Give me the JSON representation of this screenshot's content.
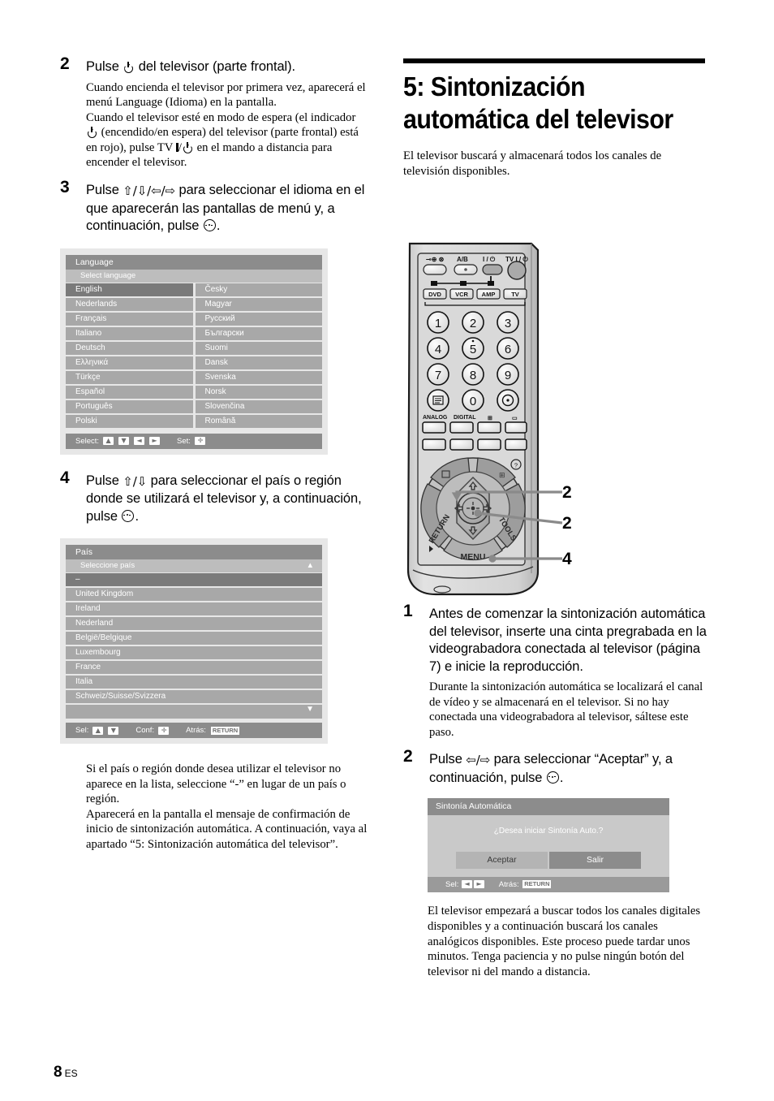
{
  "left_column": {
    "step2": {
      "num": "2",
      "head_pre": "Pulse ",
      "head_post": " del televisor (parte frontal).",
      "body_p1": "Cuando encienda el televisor por primera vez, aparecerá el menú Language (Idioma) en la pantalla.",
      "body_p2_a": "Cuando el televisor esté en modo de espera (el indicador ",
      "body_p2_b": " (encendido/en espera) del televisor (parte frontal) está en rojo), pulse TV ",
      "body_p2_c": " en el mando a distancia para encender el televisor."
    },
    "step3": {
      "num": "3",
      "head_a": "Pulse ",
      "head_arrows": "⇧/⇩/⇦/⇨",
      "head_b": " para seleccionar el idioma en el que aparecerán las pantallas de menú y, a continuación, pulse ",
      "head_c": "."
    },
    "language_menu": {
      "title": "Language",
      "subtitle": "Select language",
      "column_left": [
        "English",
        "Nederlands",
        "Français",
        "Italiano",
        "Deutsch",
        "Ελληνικά",
        "Türkçe",
        "Español",
        "Português",
        "Polski"
      ],
      "column_right": [
        "Česky",
        "Magyar",
        "Русский",
        "Български",
        "Suomi",
        "Dansk",
        "Svenska",
        "Norsk",
        "Slovenčina",
        "Română"
      ],
      "selected": "English",
      "footer_select_label": "Select:",
      "footer_set_label": "Set:"
    },
    "step4": {
      "num": "4",
      "head_a": "Pulse ",
      "head_arrows": "⇧/⇩",
      "head_b": " para seleccionar el país o región donde se utilizará el televisor y, a continuación, pulse ",
      "head_c": "."
    },
    "country_menu": {
      "title": "País",
      "subtitle": "Seleccione país",
      "rows": [
        "–",
        "United Kingdom",
        "Ireland",
        "Nederland",
        "België/Belgique",
        "Luxembourg",
        "France",
        "Italia",
        "Schweiz/Suisse/Svizzera"
      ],
      "selected": "–",
      "footer_sel_label": "Sel:",
      "footer_conf_label": "Conf:",
      "footer_back_label": "Atrás:",
      "footer_back_key": "RETURN"
    },
    "closing_paragraphs": [
      "Si el país o región donde desea utilizar el televisor no aparece en la lista, seleccione “-” en lugar de un país o región.",
      "Aparecerá en la pantalla el mensaje de confirmación de inicio de sintonización automática. A continuación, vaya al apartado “5: Sintonización automática del televisor”."
    ]
  },
  "right_column": {
    "heading": "5: Sintonización automática del televisor",
    "intro": "El televisor buscará y almacenará todos los canales de televisión disponibles.",
    "remote": {
      "top_labels": {
        "ab": "A/B",
        "power": "I / ⏻",
        "tv_power": "TV I / ⏻"
      },
      "mode_buttons": [
        "DVD",
        "VCR",
        "AMP",
        "TV"
      ],
      "numeric_keys": [
        "1",
        "2",
        "3",
        "4",
        "5",
        "6",
        "7",
        "8",
        "9",
        "0"
      ],
      "function_labels": [
        "ANALOG",
        "DIGITAL"
      ],
      "menu_label": "MENU",
      "return_label": "RETURN",
      "tools_label": "TOOLS",
      "help_label": "?",
      "callouts": [
        "2",
        "2",
        "4"
      ]
    },
    "step1": {
      "num": "1",
      "head": "Antes de comenzar la sintonización automática del televisor, inserte una cinta pregrabada en la videograbadora conectada al televisor (página 7) e inicie la reproducción.",
      "body": "Durante la sintonización automática se localizará el canal de vídeo y se almacenará en el televisor. Si no hay conectada una videograbadora al televisor, sáltese este paso."
    },
    "step2": {
      "num": "2",
      "head_a": "Pulse ",
      "head_arrows": "⇦/⇨",
      "head_b": " para seleccionar “Aceptar” y, a continuación, pulse ",
      "head_c": "."
    },
    "autotune_dialog": {
      "title": "Sintonía Automática",
      "question": "¿Desea iniciar Sintonía Auto.?",
      "button_ok": "Aceptar",
      "button_exit": "Salir",
      "footer_sel_label": "Sel:",
      "footer_back_label": "Atrás:",
      "footer_back_key": "RETURN"
    },
    "closing_paragraph": "El televisor empezará a buscar todos los canales digitales disponibles y a continuación buscará los canales analógicos disponibles. Este proceso puede tardar unos minutos. Tenga paciencia y no pulse ningún botón del televisor ni del mando a distancia."
  },
  "footer": {
    "page_number": "8",
    "locale": "ES"
  },
  "colors": {
    "osd_title": "#8c8c8c",
    "osd_subtitle": "#bdbdbd",
    "osd_item": "#a8a8a8",
    "osd_selected": "#7a7a7a",
    "osd_background": "#e7e7e7",
    "dialog_body": "#c9c9c9"
  }
}
